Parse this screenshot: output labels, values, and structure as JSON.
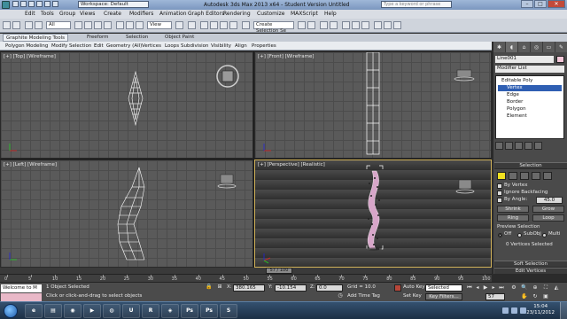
{
  "app": {
    "title": "Autodesk 3ds Max 2013 x64   -  Student Version     Untitled",
    "workspace": "Workspace: Default",
    "search_placeholder": "Type a keyword or phrase"
  },
  "menu": [
    "Edit",
    "Tools",
    "Group",
    "Views",
    "Create",
    "Modifiers",
    "Animation",
    "Graph Editors",
    "Rendering",
    "Customize",
    "MAXScript",
    "Help"
  ],
  "toolbar": {
    "selection_filter": "All",
    "coord_system": "View",
    "named_selection": "Create Selection Se"
  },
  "ribbon": {
    "tabs": [
      "Graphite Modeling Tools",
      "Freeform",
      "Selection",
      "Object Paint"
    ],
    "panels": [
      "Polygon Modeling",
      "Modify Selection",
      "Edit",
      "Geometry (All)",
      "Vertices",
      "Loops",
      "Subdivision",
      "Visibility",
      "Align",
      "Properties"
    ]
  },
  "viewports": {
    "top": "[+] [Top] [Wireframe]",
    "front": "[+] [Front] [Wireframe]",
    "left": "[+] [Left] [Wireframe]",
    "perspective": "[+] [Perspective] [Realistic]"
  },
  "command_panel": {
    "object_name": "Line001",
    "object_color": "#f2c6d7",
    "modifier_list": "Modifier List",
    "stack": [
      "Editable Poly",
      "Vertex",
      "Edge",
      "Border",
      "Polygon",
      "Element"
    ],
    "selected_index": 1,
    "rollouts": {
      "selection": "Selection",
      "soft_selection": "Soft Selection",
      "edit_vertices": "Edit Vertices"
    },
    "by_vertex": "By Vertex",
    "ignore_backfacing": "Ignore Backfacing",
    "by_angle": "By Angle:",
    "by_angle_value": "45.0",
    "shrink": "Shrink",
    "grow": "Grow",
    "ring": "Ring",
    "loop": "Loop",
    "preview_selection": "Preview Selection",
    "preview_options": [
      "Off",
      "SubObj",
      "Multi"
    ],
    "selected_count": "0 Vertices Selected"
  },
  "time": {
    "slider": "57 / 100",
    "ticks": [
      "0",
      "5",
      "10",
      "15",
      "20",
      "25",
      "30",
      "35",
      "40",
      "45",
      "50",
      "55",
      "60",
      "65",
      "70",
      "75",
      "80",
      "85",
      "90",
      "95",
      "100"
    ]
  },
  "status": {
    "script_text": "Welcome to M",
    "message1": "1 Object Selected",
    "message2": "Click or click-and-drag to select objects",
    "x_label": "X:",
    "x": "380.165",
    "y_label": "Y:",
    "y": "-10.154",
    "z_label": "Z:",
    "z": "0.0",
    "grid": "Grid = 10.0",
    "add_time_tag": "Add Time Tag",
    "auto_key": "Auto Key",
    "set_key": "Set Key",
    "selected": "Selected",
    "key_filters": "Key Filters...",
    "frame": "57"
  },
  "taskbar": {
    "time": "15:04",
    "date": "23/11/2012",
    "apps": [
      "ie-icon",
      "explorer-icon",
      "chrome-icon",
      "media-player-icon",
      "firefox-icon",
      "udk-icon",
      "riff-icon",
      "max-icon",
      "photoshop-icon",
      "photoshop-2-icon",
      "skype-icon"
    ]
  }
}
